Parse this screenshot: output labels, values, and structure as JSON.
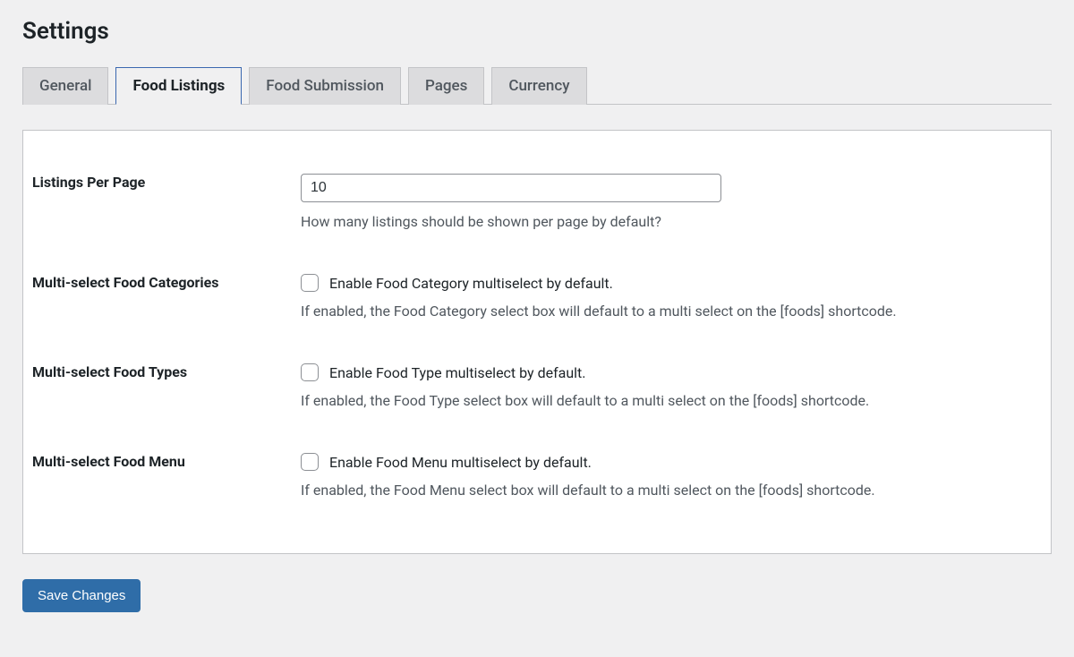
{
  "page": {
    "title": "Settings"
  },
  "tabs": {
    "general": "General",
    "food_listings": "Food Listings",
    "food_submission": "Food Submission",
    "pages": "Pages",
    "currency": "Currency"
  },
  "form": {
    "listings_per_page": {
      "label": "Listings Per Page",
      "value": "10",
      "description": "How many listings should be shown per page by default?"
    },
    "multi_categories": {
      "label": "Multi-select Food Categories",
      "checkbox_label": "Enable Food Category multiselect by default.",
      "description": "If enabled, the Food Category select box will default to a multi select on the [foods] shortcode."
    },
    "multi_types": {
      "label": "Multi-select Food Types",
      "checkbox_label": "Enable Food Type multiselect by default.",
      "description": "If enabled, the Food Type select box will default to a multi select on the [foods] shortcode."
    },
    "multi_menu": {
      "label": "Multi-select Food Menu",
      "checkbox_label": "Enable Food Menu multiselect by default.",
      "description": "If enabled, the Food Menu select box will default to a multi select on the [foods] shortcode."
    }
  },
  "buttons": {
    "save": "Save Changes"
  }
}
